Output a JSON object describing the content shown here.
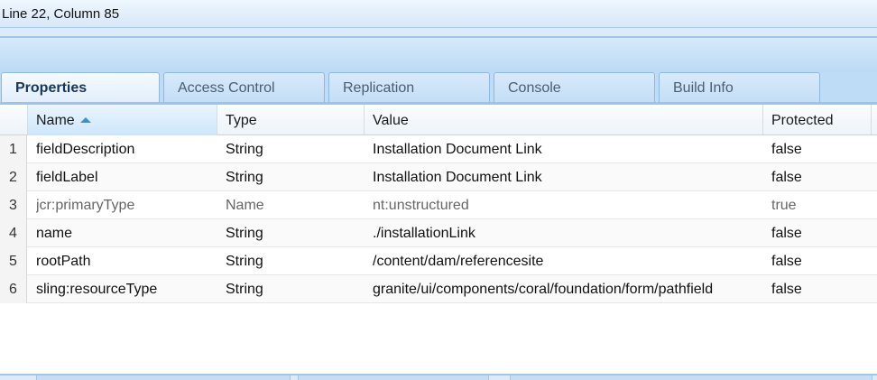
{
  "status": {
    "text": "Line 22, Column 85"
  },
  "tabs": [
    {
      "label": "Properties",
      "active": true
    },
    {
      "label": "Access Control",
      "active": false
    },
    {
      "label": "Replication",
      "active": false
    },
    {
      "label": "Console",
      "active": false
    },
    {
      "label": "Build Info",
      "active": false
    }
  ],
  "grid": {
    "columns": [
      "Name",
      "Type",
      "Value",
      "Protected"
    ],
    "sort": {
      "column": "Name",
      "direction": "ascending"
    },
    "rows": [
      {
        "num": "1",
        "name": "fieldDescription",
        "type": "String",
        "value": "Installation Document Link",
        "protected": "false"
      },
      {
        "num": "2",
        "name": "fieldLabel",
        "type": "String",
        "value": "Installation Document Link",
        "protected": "false"
      },
      {
        "num": "3",
        "name": "jcr:primaryType",
        "type": "Name",
        "value": "nt:unstructured",
        "protected": "true"
      },
      {
        "num": "4",
        "name": "name",
        "type": "String",
        "value": "./installationLink",
        "protected": "false"
      },
      {
        "num": "5",
        "name": "rootPath",
        "type": "String",
        "value": "/content/dam/referencesite",
        "protected": "false"
      },
      {
        "num": "6",
        "name": "sling:resourceType",
        "type": "String",
        "value": "granite/ui/components/coral/foundation/form/pathfield",
        "protected": "false"
      }
    ]
  },
  "colors": {
    "accent": "#3a8fd6",
    "tab_active_text": "#16375a",
    "tab_text": "#4a5d72"
  }
}
